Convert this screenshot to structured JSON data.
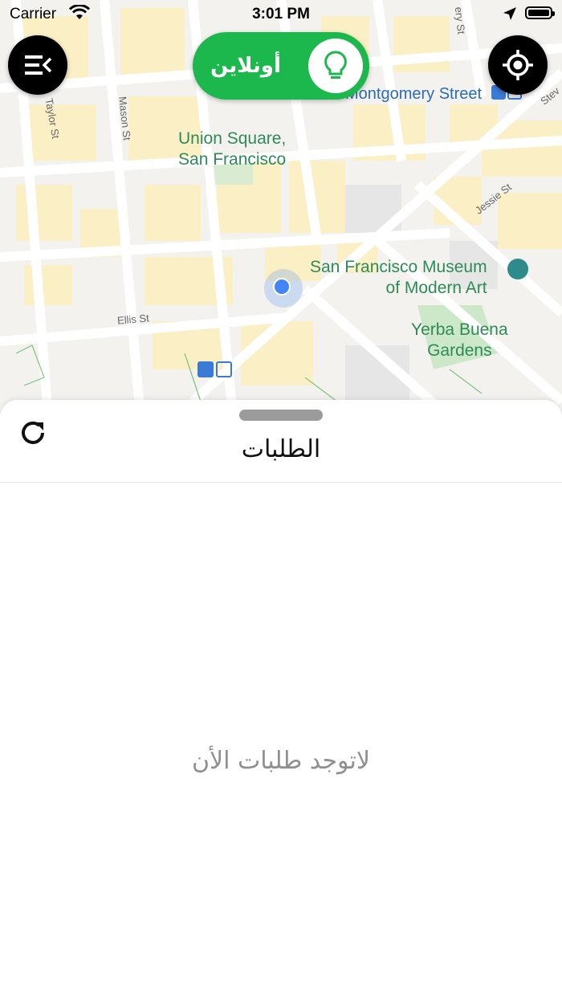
{
  "status_bar": {
    "carrier": "Carrier",
    "time": "3:01 PM"
  },
  "toggle": {
    "label": "أونلاين",
    "state": "online",
    "color": "#1cb84d"
  },
  "map": {
    "places": [
      {
        "name": "Union Square,\nSan Francisco"
      },
      {
        "name": "San Francisco Museum\nof Modern Art"
      },
      {
        "name": "Yerba Buena\nGardens"
      }
    ],
    "streets": [
      "Montgomery Street",
      "Taylor St",
      "Mason St",
      "Ellis St",
      "Jessie St",
      "Stev",
      "ery St"
    ]
  },
  "sheet": {
    "title": "الطلبات",
    "empty_message": "لاتوجد طلبات الأن"
  },
  "icons": {
    "menu": "menu-collapse-icon",
    "locate": "crosshair-icon",
    "toggle": "lightbulb-icon",
    "refresh": "refresh-icon"
  }
}
